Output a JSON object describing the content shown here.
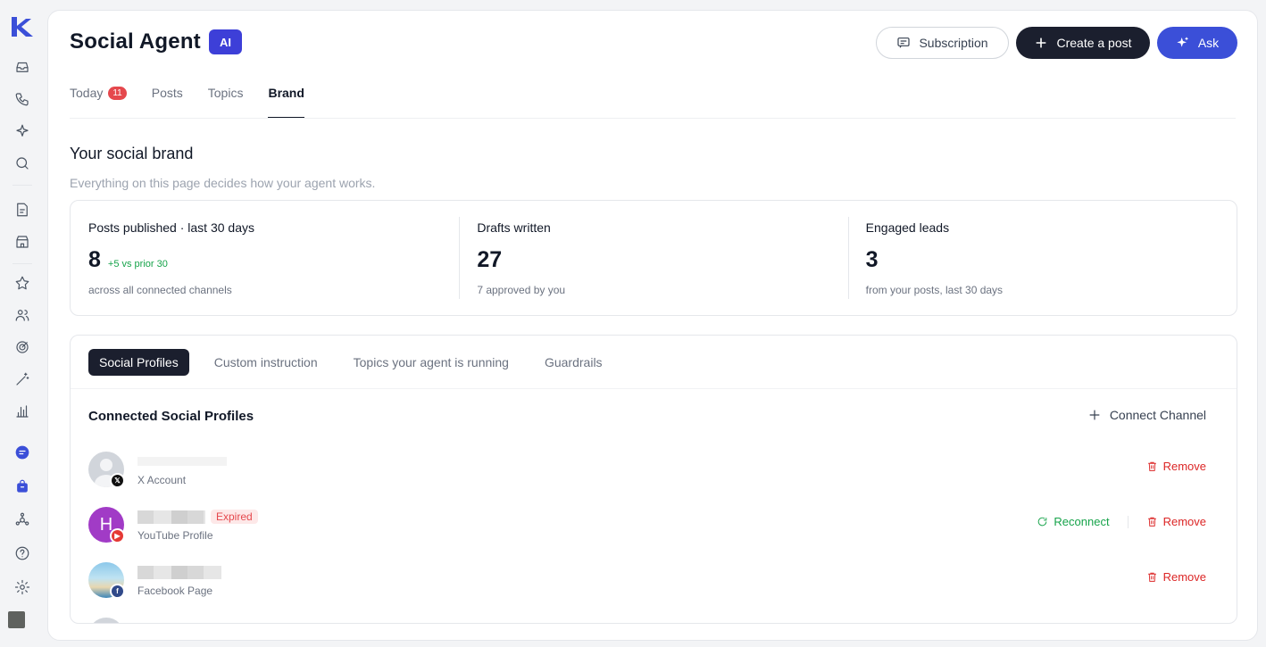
{
  "header": {
    "title": "Social Agent",
    "badge": "AI",
    "subscription_label": "Subscription",
    "create_label": "Create a post",
    "ask_label": "Ask"
  },
  "tabs": [
    {
      "label": "Today",
      "badge": "11"
    },
    {
      "label": "Posts"
    },
    {
      "label": "Topics"
    },
    {
      "label": "Brand",
      "active": true
    }
  ],
  "section": {
    "title": "Your social brand",
    "subtitle": "Everything on this page decides how your agent works."
  },
  "stats": [
    {
      "label": "Posts published · last 30 days",
      "value": "8",
      "delta": "+5 vs prior 30",
      "note": "across all connected channels"
    },
    {
      "label": "Drafts written",
      "value": "27",
      "note": "7 approved by you"
    },
    {
      "label": "Engaged leads",
      "value": "3",
      "note": "from your posts, last 30 days"
    }
  ],
  "subtabs": [
    "Social Profiles",
    "Custom instruction",
    "Topics your agent is running",
    "Guardrails"
  ],
  "profiles_panel": {
    "title": "Connected Social Profiles",
    "connect_label": "Connect Channel",
    "profiles": [
      {
        "type": "X Account",
        "network": "x",
        "remove": "Remove"
      },
      {
        "type": "YouTube Profile",
        "network": "youtube",
        "avatar_letter": "H",
        "status": "Expired",
        "reconnect": "Reconnect",
        "remove": "Remove"
      },
      {
        "type": "Facebook Page",
        "network": "facebook",
        "remove": "Remove"
      }
    ]
  },
  "colors": {
    "accent": "#3b4fd8",
    "dark_button": "#1b1f2e",
    "danger": "#dc2626",
    "success": "#16a34a"
  }
}
